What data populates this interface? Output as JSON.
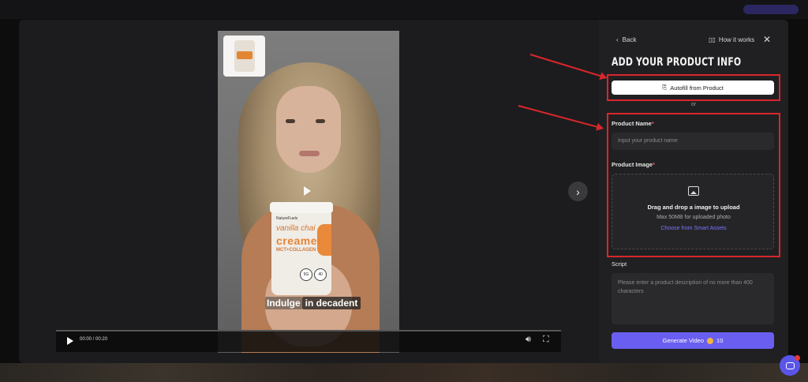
{
  "preview": {
    "time": "00:00 / 00:20",
    "caption_part1": "Indulge",
    "caption_part2": "in decadent",
    "jar": {
      "brand": "NatureFuels",
      "line1": "vanilla chai",
      "line2": "creamer",
      "line3": "MCT+COLLAGEN",
      "badge1": "5G",
      "badge2": "40"
    }
  },
  "panel": {
    "back_label": "Back",
    "how_label": "How it works",
    "title": "ADD YOUR PRODUCT INFO",
    "autofill_label": "Autofill from Product",
    "or_label": "or",
    "product_name_label": "Product Name",
    "required_mark": "*",
    "product_name_placeholder": "Input your product name",
    "product_image_label": "Product Image",
    "drop_title": "Drag and drop a image to upload",
    "drop_sub": "Max 50MB for uploaded photo",
    "drop_link": "Choose from Smart Assets",
    "script_label": "Script",
    "script_placeholder": "Please enter a product description of no more than 400 characters",
    "generate_label": "Generate Video",
    "generate_cost": "10"
  },
  "colors": {
    "accent": "#6a5ef0",
    "highlight": "#d9262b",
    "link": "#7b74ff"
  }
}
